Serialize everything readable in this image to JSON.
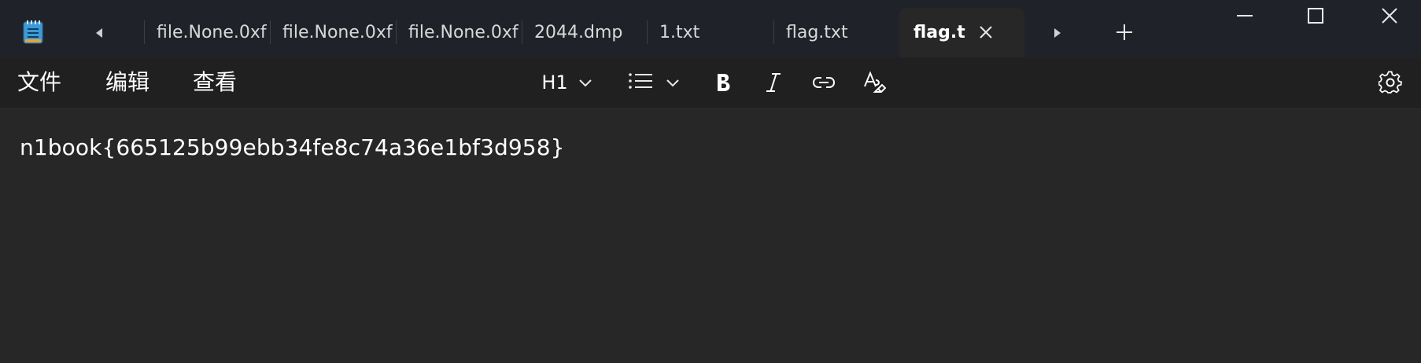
{
  "app": {
    "icon": "notepad-icon"
  },
  "tabs": [
    {
      "label": "file.None.0xf",
      "active": false
    },
    {
      "label": "file.None.0xf",
      "active": false
    },
    {
      "label": "file.None.0xf",
      "active": false
    },
    {
      "label": "2044.dmp",
      "active": false
    },
    {
      "label": "1.txt",
      "active": false
    },
    {
      "label": "flag.txt",
      "active": false
    },
    {
      "label": "flag.tx",
      "active": true
    }
  ],
  "window_controls": [
    "minimize-icon",
    "maximize-icon",
    "close-icon"
  ],
  "menu": {
    "file": "文件",
    "edit": "编辑",
    "view": "查看"
  },
  "toolbar": {
    "heading_label": "H1",
    "icons": [
      "chevron-down-icon",
      "list-icon",
      "bold-icon",
      "italic-icon",
      "link-icon",
      "clear-formatting-icon",
      "settings-icon"
    ]
  },
  "editor": {
    "content": "n1book{665125b99ebb34fe8c74a36e1bf3d958}"
  },
  "colors": {
    "titlebar_bg": "#1f2329",
    "menubar_bg": "#202020",
    "editor_bg": "#272727",
    "text": "#ffffff"
  }
}
